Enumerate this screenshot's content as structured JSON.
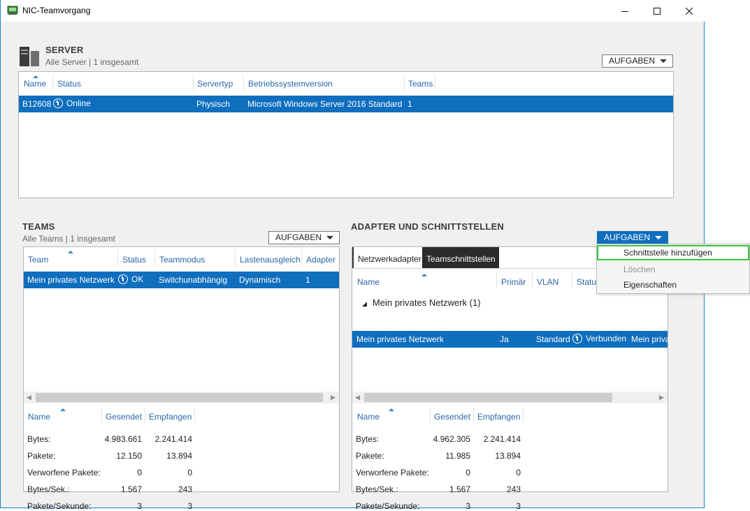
{
  "window": {
    "title": "NIC-Teamvorgang"
  },
  "server": {
    "title": "SERVER",
    "subtitle": "Alle Server | 1 insgesamt",
    "tasks_label": "AUFGABEN",
    "columns": [
      "Name",
      "Status",
      "Servertyp",
      "Betriebssystemversion",
      "Teams"
    ],
    "rows": [
      {
        "name": "B12608",
        "status": "Online",
        "type": "Physisch",
        "os": "Microsoft Windows Server 2016 Standard",
        "teams": "1"
      }
    ]
  },
  "teams": {
    "title": "TEAMS",
    "subtitle": "Alle Teams | 1 insgesamt",
    "tasks_label": "AUFGABEN",
    "columns": [
      "Team",
      "Status",
      "Teammodus",
      "Lastenausgleich",
      "Adapter"
    ],
    "rows": [
      {
        "team": "Mein privates Netzwerk",
        "status": "OK",
        "mode": "Switchunabhängig",
        "balance": "Dynamisch",
        "adapter": "1"
      }
    ],
    "stats_columns": [
      "Name",
      "Gesendet",
      "Empfangen"
    ],
    "stats": [
      {
        "name": "Bytes:",
        "sent": "4.983.661",
        "received": "2.241.414"
      },
      {
        "name": "Pakete:",
        "sent": "12.150",
        "received": "13.894"
      },
      {
        "name": "Verworfene Pakete:",
        "sent": "0",
        "received": "0"
      },
      {
        "name": "Bytes/Sek.:",
        "sent": "1.567",
        "received": "243"
      },
      {
        "name": "Pakete/Sekunde:",
        "sent": "3",
        "received": "3"
      }
    ]
  },
  "adapters": {
    "title": "ADAPTER UND SCHNITTSTELLEN",
    "tasks_label": "AUFGABEN",
    "tabs": [
      "Netzwerkadapter",
      "Teamschnittstellen"
    ],
    "columns": [
      "Name",
      "Primär",
      "VLAN",
      "Status"
    ],
    "group": "Mein privates Netzwerk (1)",
    "rows": [
      {
        "name": "Mein privates Netzwerk",
        "primary": "Ja",
        "vlan": "Standard",
        "status": "Verbunden",
        "extra": "Mein priva"
      }
    ],
    "stats_columns": [
      "Name",
      "Gesendet",
      "Empfangen"
    ],
    "stats": [
      {
        "name": "Bytes:",
        "sent": "4.962.305",
        "received": "2.241.414"
      },
      {
        "name": "Pakete:",
        "sent": "11.985",
        "received": "13.894"
      },
      {
        "name": "Verworfene Pakete:",
        "sent": "0",
        "received": "0"
      },
      {
        "name": "Bytes/Sek.:",
        "sent": "1.567",
        "received": "243"
      },
      {
        "name": "Pakete/Sekunde:",
        "sent": "3",
        "received": "3"
      }
    ]
  },
  "menu": {
    "items": [
      {
        "label": "Schnittstelle hinzufügen",
        "state": "highlighted"
      },
      {
        "label": "Löschen",
        "state": "disabled"
      },
      {
        "label": "Eigenschaften",
        "state": "enabled"
      }
    ]
  },
  "colors": {
    "accent": "#0f6ebe",
    "header_text": "#2a66a8",
    "highlight_border": "#3cc23c"
  }
}
